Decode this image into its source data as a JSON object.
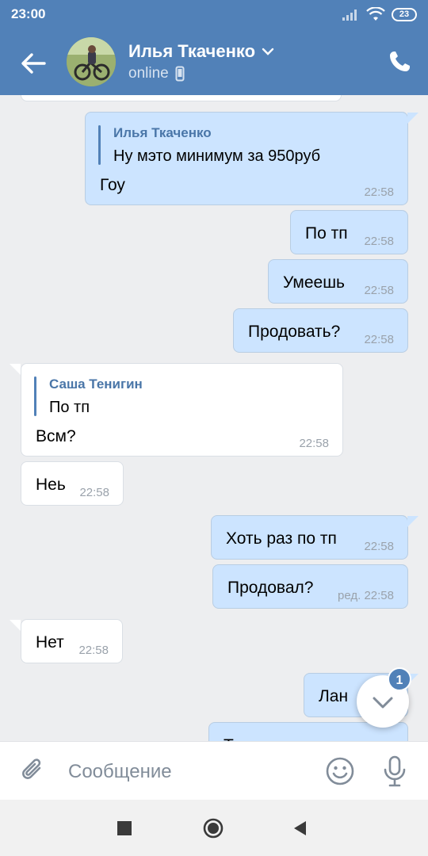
{
  "status_bar": {
    "time": "23:00",
    "battery": "23"
  },
  "header": {
    "contact_name": "Илья Ткаченко",
    "status": "online"
  },
  "messages": [
    {
      "reply_author": "Илья Ткаченко",
      "reply_text": "Ну мэто минимум за 950руб",
      "text": "Гоу",
      "time": "22:58"
    },
    {
      "text": "По тп",
      "time": "22:58"
    },
    {
      "text": "Умеешь",
      "time": "22:58"
    },
    {
      "text": "Продовать?",
      "time": "22:58"
    },
    {
      "reply_author": "Саша Тенигин",
      "reply_text": "По тп",
      "text": "Всм?",
      "time": "22:58"
    },
    {
      "text": "Неь",
      "time": "22:58"
    },
    {
      "text": "Хоть раз по тп",
      "time": "22:58"
    },
    {
      "text": "Продовал?",
      "time": "ред. 22:58"
    },
    {
      "text": "Нет",
      "time": "22:58"
    },
    {
      "text": "Лан"
    },
    {
      "text": "Т"
    }
  ],
  "scroll_down": {
    "badge": "1"
  },
  "composer": {
    "placeholder": "Сообщение"
  },
  "colors": {
    "header": "#5181b8",
    "outgoing": "#cce4ff",
    "incoming": "#ffffff",
    "background": "#edeef0"
  },
  "icons": [
    "arrow-left-icon",
    "chevron-down-icon",
    "phone-icon",
    "mobile-device-icon",
    "paperclip-icon",
    "smile-icon",
    "microphone-icon",
    "stop-icon",
    "home-icon",
    "back-triangle-icon"
  ]
}
